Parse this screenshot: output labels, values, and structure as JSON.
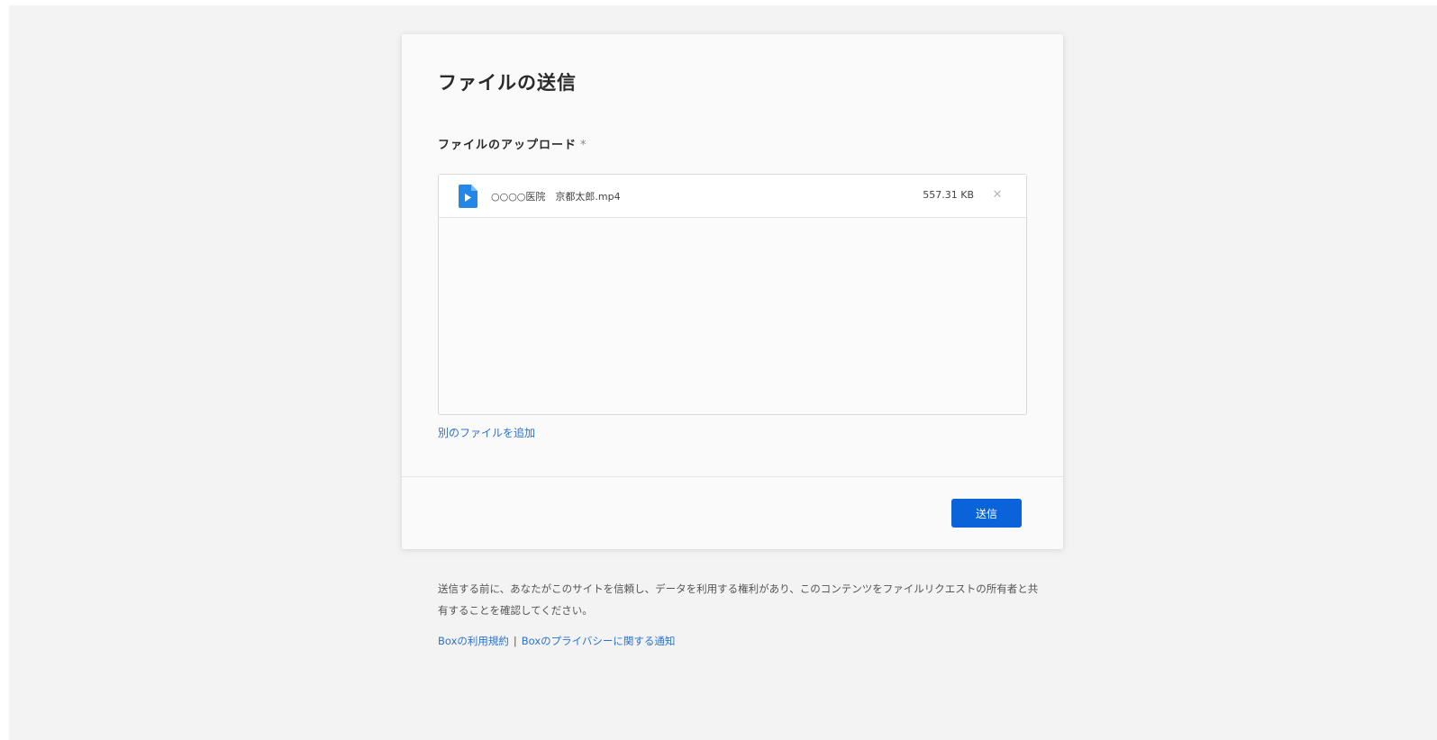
{
  "dialog": {
    "title": "ファイルの送信",
    "upload_label": "ファイルのアップロード",
    "required_mark": "*"
  },
  "file_list": {
    "items": [
      {
        "name": "○○○○医院　京都太郎.mp4",
        "size": "557.31 KB",
        "icon": "video-file-icon",
        "remove_icon": "close-icon",
        "remove_glyph": "✕"
      }
    ]
  },
  "actions": {
    "add_file_label": "別のファイルを追加",
    "submit_label": "送信"
  },
  "footer": {
    "disclaimer": "送信する前に、あなたがこのサイトを信頼し、データを利用する権利があり、このコンテンツをファイルリクエストの所有者と共有することを確認してください。",
    "terms_link": "Boxの利用規約",
    "separator": "|",
    "privacy_link": "Boxのプライバシーに関する通知"
  },
  "colors": {
    "primary_button": "#0a63d8",
    "link": "#2a71d0",
    "file_icon": "#2486e6"
  }
}
